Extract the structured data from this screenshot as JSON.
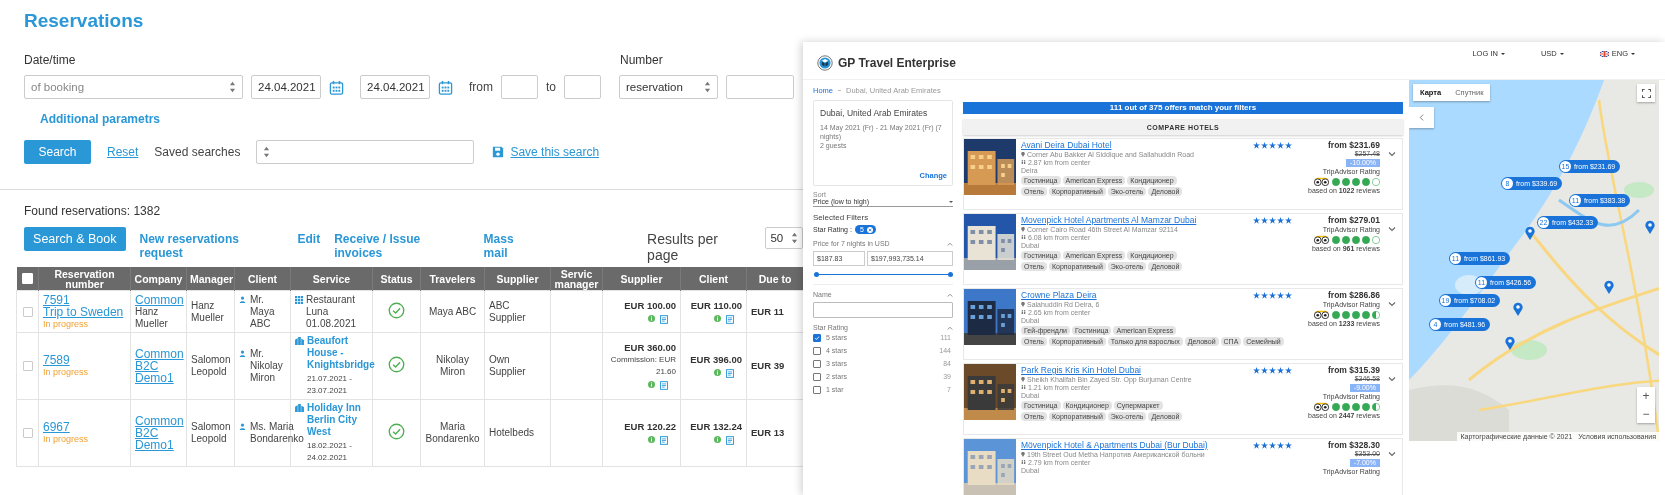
{
  "title": "Reservations",
  "filters": {
    "date_label": "Date/time",
    "date_type": "of booking",
    "date_from": "24.04.2021",
    "date_to": "24.04.2021",
    "from_label": "from",
    "to_label": "to",
    "number_label": "Number",
    "number_type": "reservation",
    "additional": "Additional parametrs",
    "search": "Search",
    "reset": "Reset",
    "saved_label": "Saved searches",
    "save": "Save this search"
  },
  "found": "Found reservations: 1382",
  "actions": {
    "primary": "Search & Book",
    "links": [
      "New reservations request",
      "Edit",
      "Receive / Issue invoices",
      "Mass mail"
    ],
    "per_page_label": "Results per page",
    "per_page": "50"
  },
  "table": {
    "header_checked": false,
    "columns": [
      "Reservation number",
      "Company",
      "Manager",
      "Client",
      "Service",
      "Status",
      "Travelers",
      "Supplier",
      "Servic manager",
      "Supplier",
      "Client",
      "Due to"
    ],
    "rows": [
      {
        "selected": false,
        "number": "7591",
        "trip": "Trip to Sweden",
        "state": "In progress",
        "company": "Common",
        "company_note": "Hanz Mueller",
        "manager": "Hanz Mueller",
        "client": "Mr. Maya ABC",
        "service": {
          "kind": "restaurant",
          "name": "Restaurant Luna",
          "dates": "01.08.2021"
        },
        "travelers": "Maya ABC",
        "supplier": "ABC Supplier",
        "supplier_price": "EUR 100.00",
        "client_price": "EUR 110.00",
        "due": "EUR 11"
      },
      {
        "selected": false,
        "number": "7589",
        "state": "In progress",
        "company": "Common B2C Demo1",
        "manager": "Salomon Leopold",
        "client": "Mr. Nikolay Miron",
        "service": {
          "kind": "hotel",
          "name": "Beaufort House - Knightsbridge",
          "dates": "21.07.2021 - 23.07.2021"
        },
        "travelers": "Nikolay Miron",
        "supplier": "Own Supplier",
        "supplier_price": "EUR 360.00",
        "commission": "Commission: EUR 21.60",
        "client_price": "EUR 396.00",
        "due": "EUR 39"
      },
      {
        "selected": false,
        "number": "6967",
        "state": "In progress",
        "company": "Common B2C Demo1",
        "manager": "Salomon Leopold",
        "client": "Ms. Maria Bondarenko",
        "service": {
          "kind": "hotel",
          "name": "Holiday Inn Berlin City West",
          "dates": "18.02.2021 - 24.02.2021"
        },
        "travelers": "Maria Bondarenko",
        "supplier": "Hotelbeds",
        "supplier_price": "EUR 120.22",
        "client_price": "EUR 132.24",
        "due": "EUR 13"
      }
    ]
  },
  "booking_site": {
    "brand": "GP Travel Enterprise",
    "nav": [
      "LOG IN",
      "USD",
      "ENG"
    ],
    "breadcrumb": [
      "Home",
      "Dubai, United Arab Emirates"
    ],
    "search": {
      "destination": "Dubai, United Arab Emirates",
      "dates": "14 May 2021 (Fr) - 21 May 2021 (Fr) (7 nights)",
      "guests": "2 guests",
      "change": "Change"
    },
    "sort": {
      "label": "Sort",
      "value": "Price (low to high)"
    },
    "selected_filters": {
      "title": "Selected Filters",
      "label": "Star Rating :",
      "chip": "5"
    },
    "price": {
      "title": "Price for 7 nights in USD",
      "min": "$187.83",
      "max": "$197,993,735.14",
      "low": {
        "level": 0
      },
      "high": {
        "level": 1
      }
    },
    "name_filter": {
      "title": "Name"
    },
    "star_filter": {
      "title": "Star Rating",
      "options": [
        {
          "label": "5 stars",
          "count": "111",
          "checked": true
        },
        {
          "label": "4 stars",
          "count": "144",
          "checked": false
        },
        {
          "label": "3 stars",
          "count": "84",
          "checked": false
        },
        {
          "label": "2 stars",
          "count": "39",
          "checked": false
        },
        {
          "label": "1 star",
          "count": "7",
          "checked": false
        }
      ]
    },
    "banner": "111 out of 375 offers match your filters",
    "compare": "COMPARE HOTELS",
    "hotels": [
      {
        "name": "Avani Deira Dubai Hotel",
        "stars": 5,
        "address": "Corner Abu Bakker Al Siddique and Sallahuddin Road",
        "distance": "2.87 km from center",
        "area": "Deira",
        "tags": [
          [
            "Гостиница",
            "American Express",
            "Кондиционер"
          ],
          [
            "Отель",
            "Корпоративный",
            "Эко-отель",
            "Деловой"
          ]
        ],
        "price": "from $231.69",
        "old_price": "$257.48",
        "discount": "-10.00%",
        "rating_label": "TripAdvisor Rating",
        "tripadvisor": {
          "stars": 4
        },
        "reviews": "based on **1022** reviews"
      },
      {
        "name": "Movenpick Hotel Apartments Al Mamzar Dubai",
        "stars": 5,
        "address": "Corner Cairo Road 46th Street Al Mamzar 92114",
        "distance": "6.08 km from center",
        "area": "Dubai",
        "tags": [
          [
            "Гостиница",
            "American Express",
            "Кондиционер"
          ],
          [
            "Отель",
            "Корпоративный",
            "Эко-отель",
            "Деловой"
          ]
        ],
        "price": "from $279.01",
        "rating_label": "TripAdvisor Rating",
        "tripadvisor": {
          "stars": 4
        },
        "reviews": "based on **961** reviews"
      },
      {
        "name": "Crowne Plaza Deira",
        "stars": 5,
        "address": "Salahuddin Rd Deira, 6",
        "distance": "2.65 km from center",
        "area": "Dubai",
        "tags": [
          [
            "Гей-френдли",
            "Гостиница",
            "American Express"
          ],
          [
            "Отель",
            "Корпоративный",
            "Только для взрослых",
            "Деловой",
            "СПА",
            "Семейный"
          ]
        ],
        "price": "from $286.86",
        "rating_label": "TripAdvisor Rating",
        "tripadvisor": {
          "stars": 4.5
        },
        "reviews": "based on **1233** reviews"
      },
      {
        "name": "Park Regis Kris Kin Hotel Dubai",
        "stars": 5,
        "address": "Sheikh Khalifah Bin Zayed Str. Opp Burjuman Centre",
        "distance": "1.21 km from center",
        "area": "Dubai",
        "tags": [
          [
            "Гостиница",
            "Кондиционер",
            "Супермаркет"
          ],
          [
            "Отель",
            "Корпоративный",
            "Эко-отель",
            "Деловой"
          ]
        ],
        "price": "from $315.39",
        "old_price": "$346.58",
        "discount": "-9.00%",
        "rating_label": "TripAdvisor Rating",
        "tripadvisor": {
          "stars": 4.5
        },
        "reviews": "based on **2447** reviews"
      },
      {
        "name": "Mövenpick Hotel & Apartments Dubai (Bur Dubai)",
        "stars": 5,
        "address": "19th Street Oud Metha Напротив Американской больни",
        "distance": "2.79 km from center",
        "area": "Dubai",
        "price": "from $328.30",
        "old_price": "$353.00",
        "discount": "-7.00%",
        "rating_label": "TripAdvisor Rating"
      }
    ],
    "map": {
      "tabs": [
        {
          "label": "Карта",
          "selected": true
        },
        {
          "label": "Спутник",
          "selected": false
        }
      ],
      "pins": [
        {
          "count": "15",
          "price": "from $231.69"
        },
        {
          "count": "8",
          "price": "from $339.69"
        },
        {
          "count": "11",
          "price": "from $383.38"
        },
        {
          "count": "22",
          "price": "from $432.33"
        },
        {
          "count": "11",
          "price": "from $861.93"
        },
        {
          "count": "11",
          "price": "from $426.56"
        },
        {
          "count": "19",
          "price": "from $708.02"
        },
        {
          "count": "4",
          "price": "from $481.96"
        }
      ],
      "zoom_in": "+",
      "zoom_out": "−",
      "attribution": "Картографические данные © 2021",
      "terms": "Условия использования"
    }
  }
}
